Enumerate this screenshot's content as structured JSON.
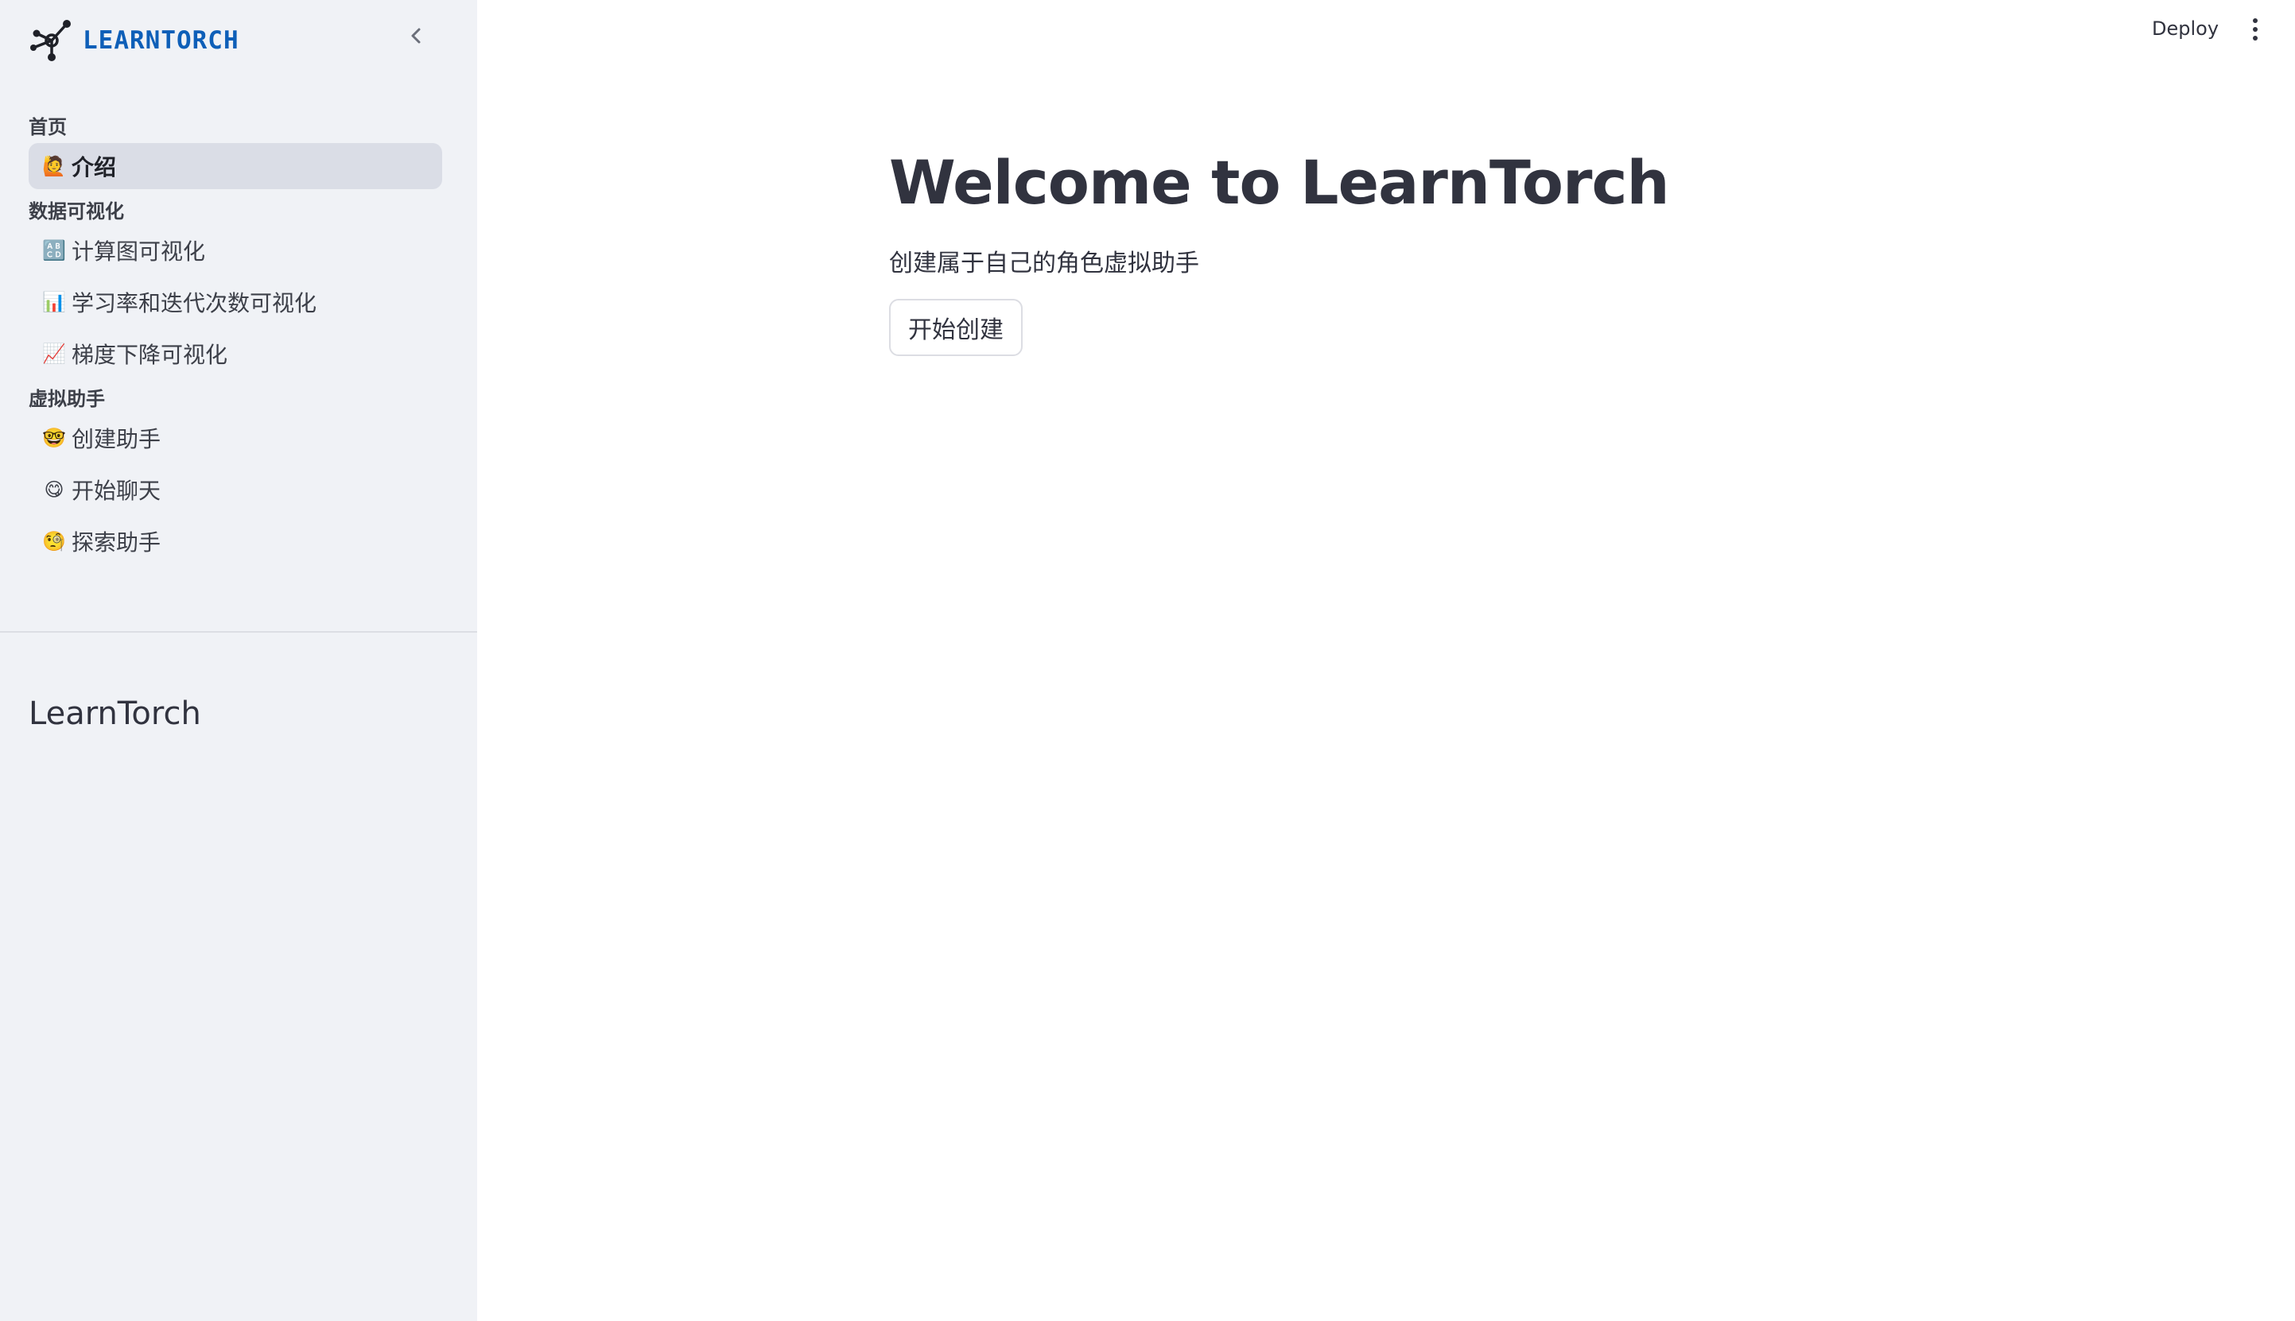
{
  "brand": {
    "name": "LEARNTORCH",
    "accent": "#0e5fb8"
  },
  "sidebar": {
    "sections": [
      {
        "header": "首页",
        "items": [
          {
            "emoji": "🙋",
            "label": "介绍",
            "active": true
          }
        ]
      },
      {
        "header": "数据可视化",
        "items": [
          {
            "emoji": "🔠",
            "label": "计算图可视化"
          },
          {
            "emoji": "📊",
            "label": "学习率和迭代次数可视化"
          },
          {
            "emoji": "📈",
            "label": "梯度下降可视化"
          }
        ]
      },
      {
        "header": "虚拟助手",
        "items": [
          {
            "emoji": "🤓",
            "label": "创建助手"
          },
          {
            "emoji": "😋",
            "label": "开始聊天"
          },
          {
            "emoji": "🧐",
            "label": "探索助手"
          }
        ]
      }
    ],
    "footer_title": "LearnTorch"
  },
  "header": {
    "deploy_label": "Deploy"
  },
  "main": {
    "title": "Welcome to LearnTorch",
    "subtitle": "创建属于自己的角色虚拟助手",
    "button_label": "开始创建"
  }
}
